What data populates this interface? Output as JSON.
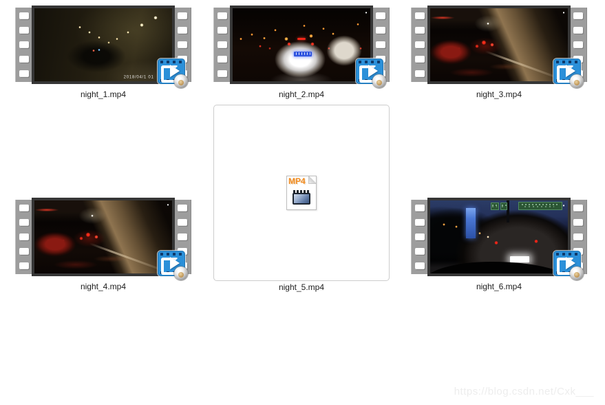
{
  "window": {
    "background": "#ffffff",
    "watermark_text": "https://blog.csdn.net/Cxk___"
  },
  "palette": {
    "player_overlay_blue": "#2b90d9",
    "player_overlay_sprocket_navy": "#0f3a6b",
    "filmstrip_gray": "#9d9d9d",
    "film_frame_dark": "#363636",
    "mp4_badge_orange": "#f28b1f",
    "filename_text": "#1c1c1c",
    "watermark_gray": "#ededed"
  },
  "files": [
    {
      "name": "night_1.mp4",
      "kind": "video-thumbnail",
      "scene": "tunnel",
      "overlay_timestamp": "2018/04/1 01"
    },
    {
      "name": "night_2.mp4",
      "kind": "video-thumbnail",
      "scene": "city"
    },
    {
      "name": "night_3.mp4",
      "kind": "video-thumbnail",
      "scene": "underpass"
    },
    {
      "name": "night_4.mp4",
      "kind": "video-thumbnail",
      "scene": "underpass"
    },
    {
      "name": "night_5.mp4",
      "kind": "mp4-placeholder",
      "icon_label": "MP4"
    },
    {
      "name": "night_6.mp4",
      "kind": "video-thumbnail",
      "scene": "dusk"
    }
  ]
}
